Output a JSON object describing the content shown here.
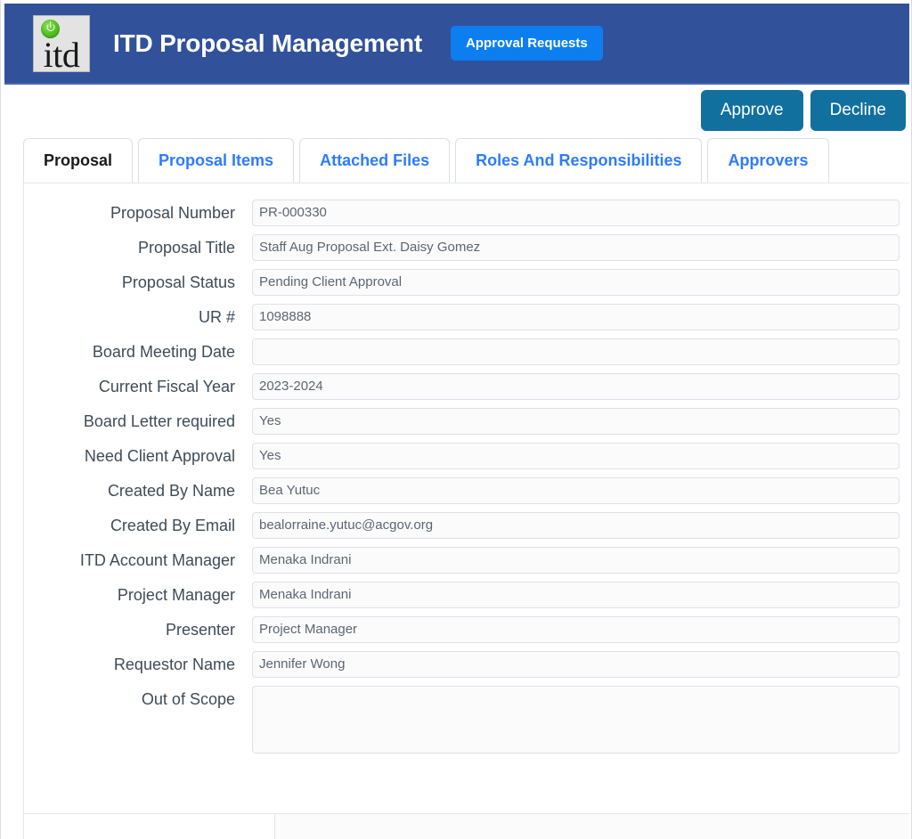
{
  "header": {
    "logo_alt": "itd",
    "logo_word": "itd",
    "title": "ITD Proposal Management",
    "approval_requests_label": "Approval Requests",
    "bg_color": "#32519b",
    "button_color": "#0d7ef0"
  },
  "actions": {
    "approve_label": "Approve",
    "decline_label": "Decline",
    "button_color": "#12709f"
  },
  "tabs": [
    {
      "label": "Proposal",
      "active": true
    },
    {
      "label": "Proposal Items",
      "active": false
    },
    {
      "label": "Attached Files",
      "active": false
    },
    {
      "label": "Roles And Responsibilities",
      "active": false
    },
    {
      "label": "Approvers",
      "active": false
    }
  ],
  "tab_colors": {
    "active_text": "#1b1b1b",
    "inactive_text": "#2d7bfd"
  },
  "form": {
    "fields": [
      {
        "label": "Proposal Number",
        "value": "PR-000330",
        "type": "text"
      },
      {
        "label": "Proposal Title",
        "value": "Staff Aug Proposal Ext. Daisy Gomez",
        "type": "text"
      },
      {
        "label": "Proposal Status",
        "value": "Pending Client Approval",
        "type": "text"
      },
      {
        "label": "UR #",
        "value": "1098888",
        "type": "text"
      },
      {
        "label": "Board Meeting Date",
        "value": "",
        "type": "text"
      },
      {
        "label": "Current Fiscal Year",
        "value": "2023-2024",
        "type": "text"
      },
      {
        "label": "Board Letter required",
        "value": "Yes",
        "type": "text"
      },
      {
        "label": "Need Client Approval",
        "value": "Yes",
        "type": "text"
      },
      {
        "label": "Created By Name",
        "value": "Bea Yutuc",
        "type": "text"
      },
      {
        "label": "Created By Email",
        "value": "bealorraine.yutuc@acgov.org",
        "type": "text"
      },
      {
        "label": "ITD Account Manager",
        "value": "Menaka Indrani",
        "type": "text"
      },
      {
        "label": "Project Manager",
        "value": "Menaka Indrani",
        "type": "text"
      },
      {
        "label": "Presenter",
        "value": "Project Manager",
        "type": "text"
      },
      {
        "label": "Requestor Name",
        "value": "Jennifer Wong",
        "type": "text"
      },
      {
        "label": "Out of Scope",
        "value": "",
        "type": "textarea"
      }
    ]
  }
}
